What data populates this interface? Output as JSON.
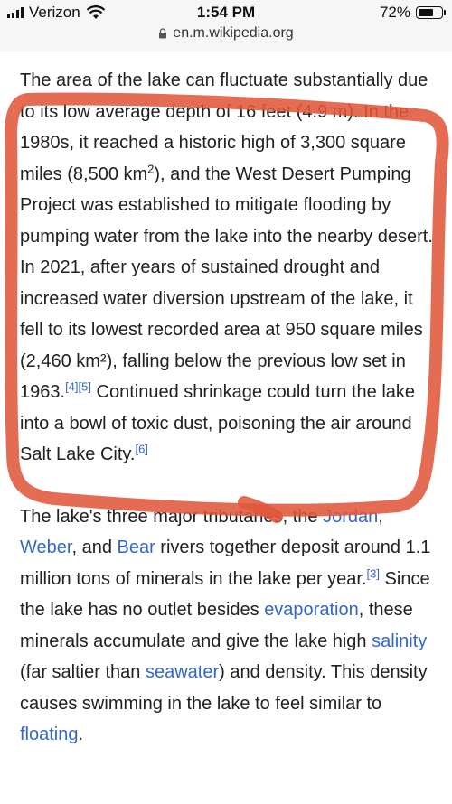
{
  "status_bar": {
    "carrier": "Verizon",
    "time": "1:54 PM",
    "battery": "72%",
    "battery_level": 0.72,
    "url": "en.m.wikipedia.org"
  },
  "article": {
    "para1": {
      "p1": "The area of the lake can fluctuate substantially due to its low average depth of 16 feet (4.9 m). In the 1980s, it reached a historic high of 3,300 square miles (8,500 km",
      "sup2": "2",
      "p2": "), and the West Desert Pumping Project was established to mitigate flooding by pumping water from the lake into the nearby desert. In 2021, after years of sustained drought and increased water diversion upstream of the lake, it fell to its lowest recorded area at 950 square miles (2,460 km²), falling below the previous low set in 1963.",
      "ref4": "[4]",
      "ref5": "[5]",
      "p3": " Continued shrinkage could turn the lake into a bowl of toxic dust, poisoning the air around Salt Lake City.",
      "ref6": "[6]"
    },
    "para2": {
      "t1": "The lake's three major tributaries, the ",
      "jordan": "Jordan",
      "t2": ", ",
      "weber": "Weber",
      "t3": ", and ",
      "bear": "Bear",
      "t4": " rivers together deposit around 1.1 million tons of minerals in the lake per year.",
      "ref3": "[3]",
      "t5": " Since the lake has no outlet besides ",
      "evaporation": "evaporation",
      "t6": ", these minerals accumulate and give the lake high ",
      "salinity": "salinity",
      "t7": " (far saltier than ",
      "seawater": "seawater",
      "t8": ") and density. This density causes swimming in the lake to feel similar to ",
      "floating": "floating",
      "t9": "."
    }
  },
  "colors": {
    "link": "#3366cc",
    "annotation": "#e0583a"
  }
}
